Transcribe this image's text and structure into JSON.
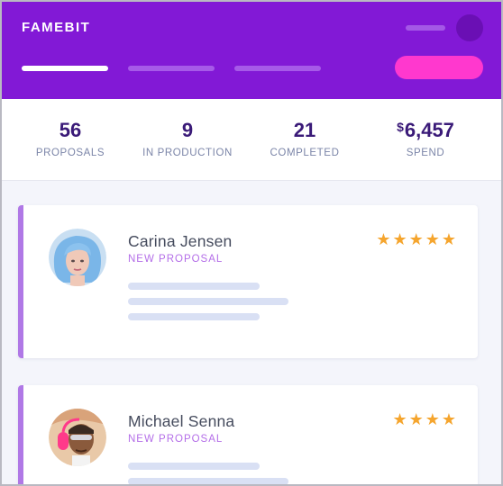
{
  "header": {
    "logo": "FAMEBIT"
  },
  "stats": [
    {
      "value": "56",
      "label": "PROPOSALS"
    },
    {
      "value": "9",
      "label": "IN PRODUCTION"
    },
    {
      "value": "21",
      "label": "COMPLETED"
    },
    {
      "currency": "$",
      "value": "6,457",
      "label": "SPEND"
    }
  ],
  "cards": [
    {
      "name": "Carina Jensen",
      "status": "NEW PROPOSAL",
      "stars": "★★★★★",
      "rating": 5
    },
    {
      "name": "Michael Senna",
      "status": "NEW PROPOSAL",
      "stars": "★★★★",
      "rating": 4
    }
  ],
  "colors": {
    "header": "#8219d6",
    "cta": "#ff38ce",
    "accent": "#b078e6",
    "star": "#f5a52e"
  }
}
